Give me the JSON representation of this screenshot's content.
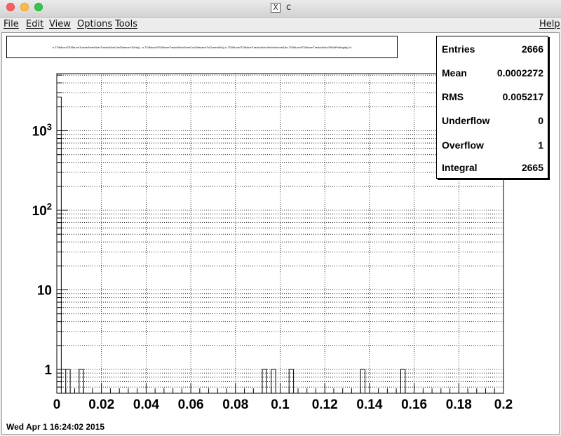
{
  "window": {
    "title": "c"
  },
  "menubar": {
    "items": [
      {
        "label": "File"
      },
      {
        "label": "Edit"
      },
      {
        "label": "View"
      },
      {
        "label": "Options"
      },
      {
        "label": "Tools"
      }
    ],
    "help": "Help"
  },
  "formula": "n-TDiMuon/ITDiMuonTracks/Nvtx/NvtxTracks/NvtxCut/DistanceToVtx() : n-TDiMuon/ITDiMuonTracks/Nvtx/NvtxCut/DistanceToClosestVtx() n-TDiMuon/ITDiMuonTracks/Nvtx/NvtxVolume&&n-TDiMuon/ITDiMuonTracks/Nvtx/DiMuPhiAngle()>0",
  "stats": [
    {
      "label": "Entries",
      "value": "2666"
    },
    {
      "label": "Mean",
      "value": "0.0002272"
    },
    {
      "label": "RMS",
      "value": "0.005217"
    },
    {
      "label": "Underflow",
      "value": "0"
    },
    {
      "label": "Overflow",
      "value": "1"
    },
    {
      "label": "Integral",
      "value": "2665"
    }
  ],
  "date": "Wed Apr  1 16:24:02 2015",
  "chart_data": {
    "type": "bar",
    "histogram": true,
    "x_scale": "linear",
    "y_scale": "log",
    "xlim": [
      0,
      0.2
    ],
    "ylim": [
      0.55,
      4500
    ],
    "grid": true,
    "x_ticks": [
      0,
      0.02,
      0.04,
      0.06,
      0.08,
      0.1,
      0.12,
      0.14,
      0.16,
      0.18,
      0.2
    ],
    "x_tick_labels": [
      "0",
      "0.02",
      "0.04",
      "0.06",
      "0.08",
      "0.1",
      "0.12",
      "0.14",
      "0.16",
      "0.18",
      "0.2"
    ],
    "y_ticks": [
      1,
      10,
      100,
      1000
    ],
    "y_tick_labels": [
      "1",
      "10",
      "10^2",
      "10^3"
    ],
    "bins": [
      {
        "x_low": 0.0,
        "x_high": 0.002,
        "count": 2656
      },
      {
        "x_low": 0.004,
        "x_high": 0.006,
        "count": 1
      },
      {
        "x_low": 0.01,
        "x_high": 0.012,
        "count": 1
      },
      {
        "x_low": 0.092,
        "x_high": 0.094,
        "count": 1
      },
      {
        "x_low": 0.096,
        "x_high": 0.098,
        "count": 1
      },
      {
        "x_low": 0.104,
        "x_high": 0.106,
        "count": 1
      },
      {
        "x_low": 0.136,
        "x_high": 0.138,
        "count": 1
      },
      {
        "x_low": 0.154,
        "x_high": 0.156,
        "count": 1
      }
    ]
  }
}
